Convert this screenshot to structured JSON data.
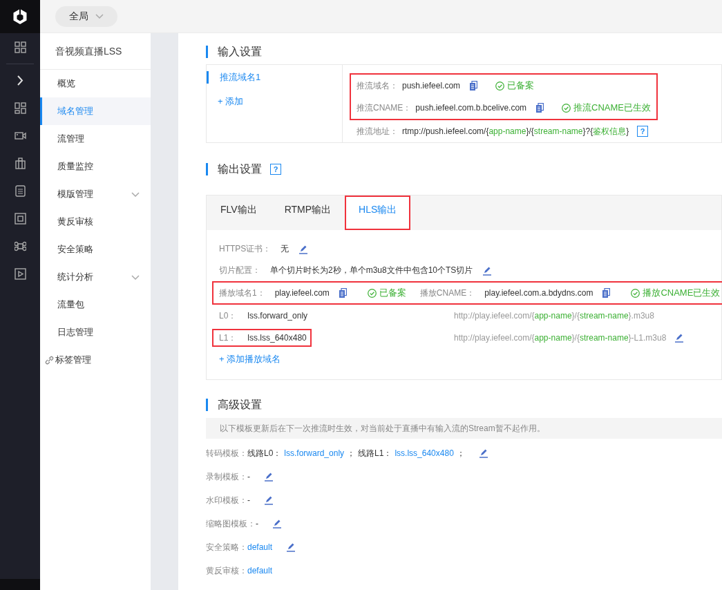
{
  "top_bar": {
    "scope": "全局"
  },
  "sidebar": {
    "title": "音视频直播LSS",
    "items": [
      {
        "label": "概览",
        "selected": false,
        "kind": "link"
      },
      {
        "label": "域名管理",
        "selected": true,
        "kind": "link"
      },
      {
        "label": "流管理",
        "selected": false,
        "kind": "link"
      },
      {
        "label": "质量监控",
        "selected": false,
        "kind": "link"
      },
      {
        "label": "模版管理",
        "selected": false,
        "kind": "group"
      },
      {
        "label": "黄反审核",
        "selected": false,
        "kind": "link"
      },
      {
        "label": "安全策略",
        "selected": false,
        "kind": "link"
      },
      {
        "label": "统计分析",
        "selected": false,
        "kind": "group"
      },
      {
        "label": "流量包",
        "selected": false,
        "kind": "link"
      },
      {
        "label": "日志管理",
        "selected": false,
        "kind": "link"
      },
      {
        "label": "标签管理",
        "selected": false,
        "kind": "tag"
      }
    ]
  },
  "input_settings": {
    "title": "输入设置",
    "domains": [
      {
        "label": "推流域名1",
        "selected": true
      }
    ],
    "add": "+ 添加",
    "highlighted": true,
    "rows": [
      {
        "label": "推流域名：",
        "value": "push.iefeel.com",
        "status": "已备案"
      },
      {
        "label": "推流CNAME：",
        "value": "push.iefeel.com.b.bcelive.com",
        "status": "推流CNAME已生效"
      }
    ],
    "address": {
      "label": "推流地址：",
      "help": "?",
      "parts": [
        {
          "text": "rtmp://push.iefeel.com/{",
          "kind": "plain"
        },
        {
          "text": "app-name",
          "kind": "var"
        },
        {
          "text": "}/{",
          "kind": "plain"
        },
        {
          "text": "stream-name",
          "kind": "var"
        },
        {
          "text": "}?{",
          "kind": "plain"
        },
        {
          "text": "鉴权信息",
          "kind": "var"
        },
        {
          "text": "}",
          "kind": "plain"
        }
      ]
    }
  },
  "output_settings": {
    "title": "输出设置",
    "help": "?",
    "tabs": [
      {
        "label": "FLV输出",
        "selected": false,
        "highlighted": false
      },
      {
        "label": "RTMP输出",
        "selected": false,
        "highlighted": false
      },
      {
        "label": "HLS输出",
        "selected": true,
        "highlighted": true
      }
    ],
    "https": {
      "label": "HTTPS证书：",
      "value": "无"
    },
    "slicing": {
      "label": "切片配置：",
      "value": "单个切片时长为2秒，单个m3u8文件中包含10个TS切片"
    },
    "play_domain": {
      "highlighted": true,
      "label": "播放域名1：",
      "value": "play.iefeel.com",
      "status": "已备案",
      "cname_label": "播放CNAME：",
      "cname": "play.iefeel.com.a.bdydns.com",
      "cname_status": "播放CNAME已生效"
    },
    "lines": [
      {
        "label": "L0：",
        "template": "lss.forward_only",
        "highlighted": false,
        "editable": false,
        "url": [
          {
            "text": "http://play.iefeel.com/{",
            "kind": "plain"
          },
          {
            "text": "app-name",
            "kind": "var"
          },
          {
            "text": "}/{",
            "kind": "plain"
          },
          {
            "text": "stream-name",
            "kind": "var"
          },
          {
            "text": "}.m3u8",
            "kind": "plain"
          }
        ]
      },
      {
        "label": "L1：",
        "template": "lss.lss_640x480",
        "highlighted": true,
        "editable": true,
        "url": [
          {
            "text": "http://play.iefeel.com/{",
            "kind": "plain"
          },
          {
            "text": "app-name",
            "kind": "var"
          },
          {
            "text": "}/{",
            "kind": "plain"
          },
          {
            "text": "stream-name",
            "kind": "var"
          },
          {
            "text": "}-L1.m3u8",
            "kind": "plain"
          }
        ]
      }
    ],
    "add": "+ 添加播放域名"
  },
  "advanced": {
    "title": "高级设置",
    "notice": "以下模板更新后在下一次推流时生效，对当前处于直播中有输入流的Stream暂不起作用。",
    "rows": [
      {
        "label": "转码模板：",
        "editable": true,
        "parts": [
          {
            "text": "线路L0：",
            "kind": "plain"
          },
          {
            "text": "lss.forward_only",
            "kind": "link"
          },
          {
            "text": "；",
            "kind": "plain"
          },
          {
            "text": "线路L1：",
            "kind": "plain"
          },
          {
            "text": "lss.lss_640x480",
            "kind": "link"
          },
          {
            "text": "；",
            "kind": "plain"
          }
        ]
      },
      {
        "label": "录制模板：",
        "editable": true,
        "parts": [
          {
            "text": "-",
            "kind": "plain"
          }
        ]
      },
      {
        "label": "水印模板：",
        "editable": true,
        "parts": [
          {
            "text": "-",
            "kind": "plain"
          }
        ]
      },
      {
        "label": "缩略图模板：",
        "editable": true,
        "parts": [
          {
            "text": "-",
            "kind": "plain"
          }
        ]
      },
      {
        "label": "安全策略：",
        "editable": true,
        "parts": [
          {
            "text": "default",
            "kind": "link"
          }
        ]
      },
      {
        "label": "黄反审核：",
        "editable": false,
        "parts": [
          {
            "text": "default",
            "kind": "link"
          }
        ]
      }
    ]
  }
}
